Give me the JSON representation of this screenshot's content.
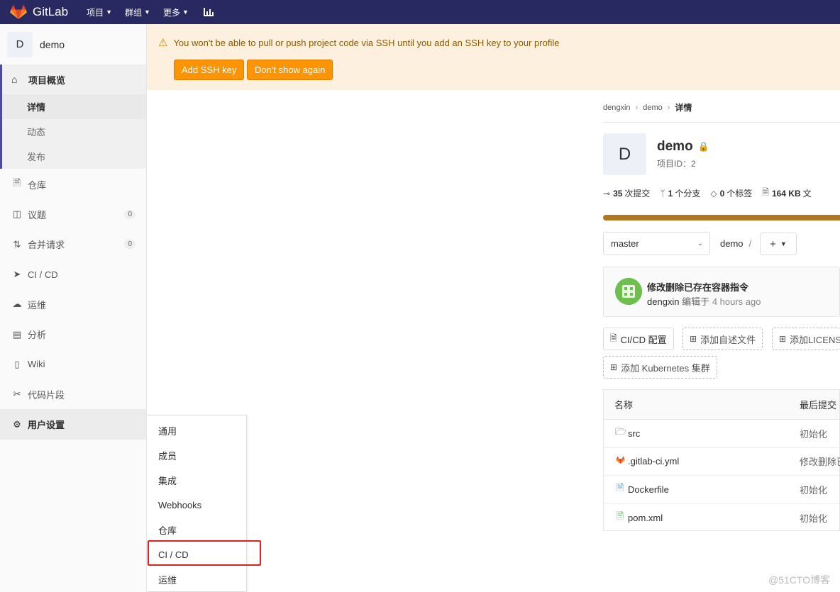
{
  "navbar": {
    "brand": "GitLab",
    "items": [
      {
        "label": "项目",
        "icon": "chevron-down-icon"
      },
      {
        "label": "群组",
        "icon": "chevron-down-icon"
      },
      {
        "label": "更多",
        "icon": "chevron-down-icon"
      }
    ],
    "chart_icon": "chart-icon",
    "color": "#292961"
  },
  "sidebar": {
    "project_avatar": "D",
    "project_name": "demo",
    "overview": {
      "title": "项目概览",
      "subs": [
        "详情",
        "动态",
        "发布"
      ]
    },
    "items": [
      {
        "label": "仓库",
        "icon": "file-icon"
      },
      {
        "label": "议题",
        "icon": "issues-icon",
        "badge": "0"
      },
      {
        "label": "合并请求",
        "icon": "merge-request-icon",
        "badge": "0"
      },
      {
        "label": "CI / CD",
        "icon": "rocket-icon"
      },
      {
        "label": "运维",
        "icon": "cloud-icon"
      },
      {
        "label": "分析",
        "icon": "chart-icon"
      },
      {
        "label": "Wiki",
        "icon": "book-icon"
      },
      {
        "label": "代码片段",
        "icon": "scissors-icon"
      },
      {
        "label": "用户设置",
        "icon": "gear-icon"
      }
    ]
  },
  "flyout": {
    "items": [
      "通用",
      "成员",
      "集成",
      "Webhooks",
      "仓库",
      "CI / CD",
      "运维"
    ]
  },
  "alert": {
    "message": "You won't be able to pull or push project code via SSH until you add an SSH key to your profile",
    "add_ssh": "Add SSH key",
    "dont_show": "Don't show again",
    "bg": "#fdf0de",
    "button_color": "#fc9403"
  },
  "breadcrumb": [
    "dengxin",
    "demo",
    "详情"
  ],
  "project": {
    "avatar": "D",
    "name": "demo",
    "id_label": "项目ID：2"
  },
  "stats": [
    {
      "value": "35",
      "label": "次提交",
      "icon": "commit-icon"
    },
    {
      "value": "1",
      "label": "个分支",
      "icon": "branch-icon"
    },
    {
      "value": "0",
      "label": "个标签",
      "icon": "tag-icon"
    },
    {
      "value": "164 KB",
      "label": "文",
      "icon": "file-icon"
    }
  ],
  "branch_select": "master",
  "path": {
    "root": "demo",
    "sep": "/"
  },
  "add_button": "+",
  "commit": {
    "title": "修改删除已存在容器指令",
    "author": "dengxin",
    "action": "编辑于",
    "time": "4 hours ago"
  },
  "quick_buttons": [
    "CI/CD 配置",
    "添加自述文件",
    "添加LICENS",
    "添加 Kubernetes 集群"
  ],
  "files": {
    "headers": [
      "名称",
      "最后提交"
    ],
    "rows": [
      {
        "name": "src",
        "msg": "初始化",
        "icon": "folder-icon"
      },
      {
        "name": ".gitlab-ci.yml",
        "msg": "修改删除已",
        "icon": "gitlab-icon"
      },
      {
        "name": "Dockerfile",
        "msg": "初始化",
        "icon": "file-icon"
      },
      {
        "name": "pom.xml",
        "msg": "初始化",
        "icon": "xml-file-icon"
      }
    ]
  },
  "watermark": "@51CTO博客"
}
